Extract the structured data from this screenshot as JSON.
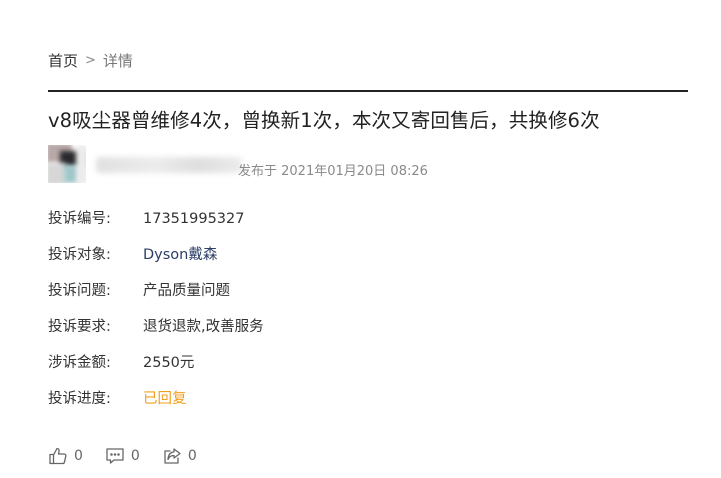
{
  "breadcrumb": {
    "home": "首页",
    "separator": ">",
    "current": "详情"
  },
  "complaint": {
    "title": "v8吸尘器曾维修4次，曾换新1次，本次又寄回售后，共换修6次",
    "publish_text": "发布于 2021年01月20日 08:26",
    "fields": [
      {
        "label": "投诉编号:",
        "value": "17351995327"
      },
      {
        "label": "投诉对象:",
        "value": "Dyson戴森"
      },
      {
        "label": "投诉问题:",
        "value": "产品质量问题"
      },
      {
        "label": "投诉要求:",
        "value": "退货退款,改善服务"
      },
      {
        "label": "涉诉金额:",
        "value": "2550元"
      },
      {
        "label": "投诉进度:",
        "value": "已回复"
      }
    ]
  },
  "actions": {
    "like_count": "0",
    "comment_count": "0",
    "share_count": "0"
  },
  "colors": {
    "status": "#f0a020",
    "link": "#2c3e66",
    "divider": "#222222"
  },
  "icons": {
    "like": "thumbs-up-icon",
    "comment": "comment-icon",
    "share": "share-icon"
  }
}
